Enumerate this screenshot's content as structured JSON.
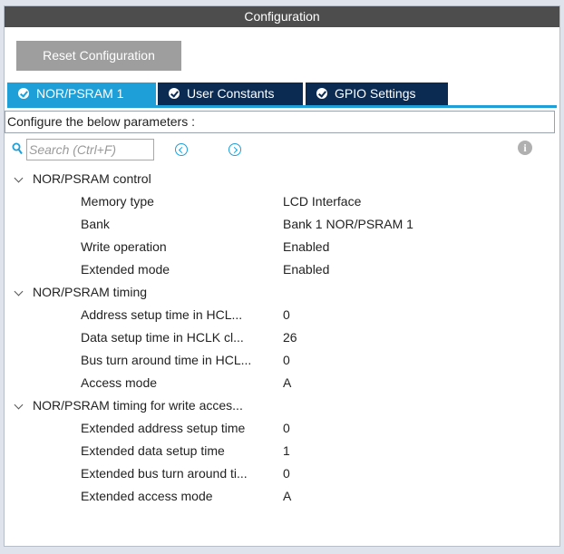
{
  "window": {
    "title": "Configuration"
  },
  "toolbar": {
    "reset_label": "Reset Configuration"
  },
  "tabs": [
    {
      "label": "NOR/PSRAM 1",
      "active": true
    },
    {
      "label": "User Constants",
      "active": false
    },
    {
      "label": "GPIO Settings",
      "active": false
    }
  ],
  "params_header": "Configure the below parameters :",
  "search": {
    "placeholder": "Search (Ctrl+F)",
    "value": ""
  },
  "icons": {
    "search": "search-icon",
    "prev": "arrow-left-circle-icon",
    "next": "arrow-right-circle-icon",
    "info": "info-icon",
    "tab_check": "check-circle-icon",
    "expand": "chevron-down-icon"
  },
  "colors": {
    "accent": "#1e9fd8",
    "tab_inactive": "#0b2b52",
    "titlebar": "#4d4d4d",
    "reset_button": "#9e9e9e"
  },
  "groups": [
    {
      "label": "NOR/PSRAM control",
      "rows": [
        {
          "name": "Memory type",
          "value": "LCD Interface"
        },
        {
          "name": "Bank",
          "value": "Bank 1 NOR/PSRAM 1"
        },
        {
          "name": "Write operation",
          "value": "Enabled"
        },
        {
          "name": "Extended mode",
          "value": "Enabled"
        }
      ]
    },
    {
      "label": "NOR/PSRAM timing",
      "rows": [
        {
          "name": "Address setup time in HCL...",
          "value": "0"
        },
        {
          "name": "Data setup time in HCLK cl...",
          "value": "26"
        },
        {
          "name": "Bus turn around time in HCL...",
          "value": "0"
        },
        {
          "name": "Access mode",
          "value": "A"
        }
      ]
    },
    {
      "label": "NOR/PSRAM timing for write acces...",
      "rows": [
        {
          "name": "Extended address setup time",
          "value": "0"
        },
        {
          "name": "Extended data setup time",
          "value": "1"
        },
        {
          "name": "Extended bus turn around ti...",
          "value": "0"
        },
        {
          "name": "Extended access mode",
          "value": "A"
        }
      ]
    }
  ]
}
